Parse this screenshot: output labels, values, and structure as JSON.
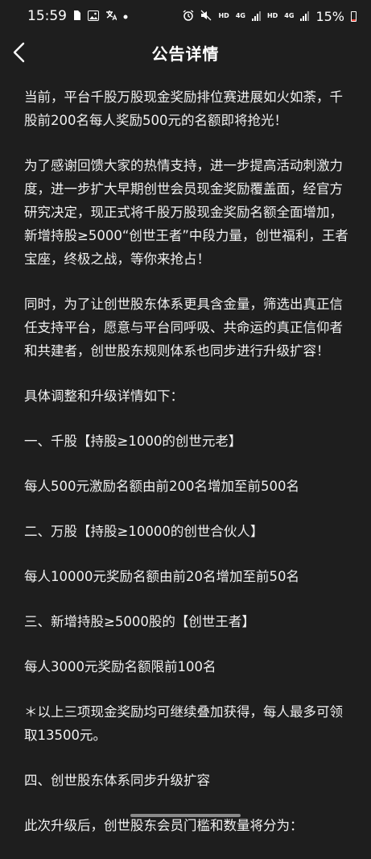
{
  "status_bar": {
    "time": "15:59",
    "network_hd_1": "HD",
    "network_4g_1": "4G",
    "network_hd_2": "HD",
    "network_4g_2": "4G",
    "battery": "15%"
  },
  "header": {
    "title": "公告详情"
  },
  "article": {
    "paragraphs": [
      "当前，平台千股万股现金奖励排位赛进展如火如荼，千股前200名每人奖励500元的名额即将抢光！",
      "为了感谢回馈大家的热情支持，进一步提高活动刺激力度，进一步扩大早期创世会员现金奖励覆盖面，经官方研究决定，现正式将千股万股现金奖励名额全面增加，新增持股≥5000“创世王者”中段力量，创世福利，王者宝座，终极之战，等你来抢占！",
      "同时，为了让创世股东体系更具含金量，筛选出真正信任支持平台，愿意与平台同呼吸、共命运的真正信仰者和共建者，创世股东规则体系也同步进行升级扩容！",
      "具体调整和升级详情如下：",
      "一、千股【持股≥1000的创世元老】",
      "每人500元激励名额由前200名增加至前500名",
      "二、万股【持股≥10000的创世合伙人】",
      "每人10000元奖励名额由前20名增加至前50名",
      "三、新增持股≥5000股的【创世王者】",
      "每人3000元奖励名额限前100名",
      "＊以上三项现金奖励均可继续叠加获得，每人最多可领取13500元。",
      "四、创世股东体系同步升级扩容",
      "此次升级后，创世股东会员门槛和数量将分为："
    ]
  },
  "colors": {
    "background": "#1e1e1e",
    "text": "#f0f0f0",
    "battery_low": "#ff4a3d"
  }
}
